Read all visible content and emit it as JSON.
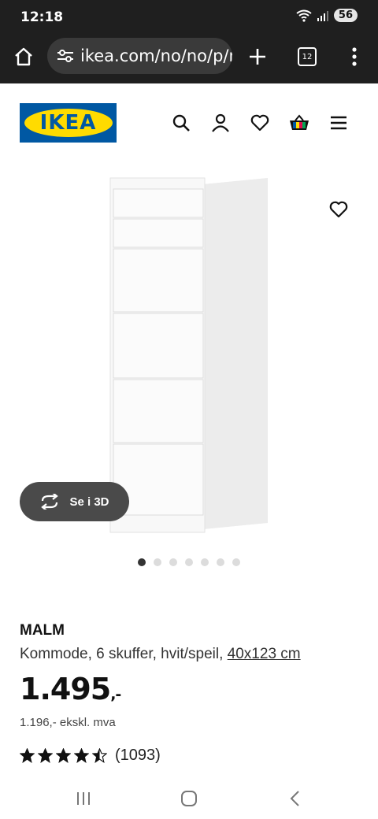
{
  "status": {
    "time": "12:18",
    "battery": "56"
  },
  "browser": {
    "url": "ikea.com/no/no/p/m",
    "tab_count": "12"
  },
  "header": {
    "logo_text": "IKEA"
  },
  "gallery": {
    "view_3d_label": "Se i 3D",
    "image_count": 7,
    "active_index": 0
  },
  "product": {
    "name": "MALM",
    "description": "Kommode, 6 skuffer, hvit/speil, ",
    "size_link": "40x123 cm",
    "price": "1.495",
    "price_suffix": ",-",
    "ex_vat": "1.196,- ekskl. mva",
    "rating_stars": 4.5,
    "rating_count": "(1093)"
  },
  "colors": {
    "ikea_blue": "#0058a3",
    "ikea_yellow": "#ffdb00",
    "chrome_dark": "#1f1f1f"
  }
}
